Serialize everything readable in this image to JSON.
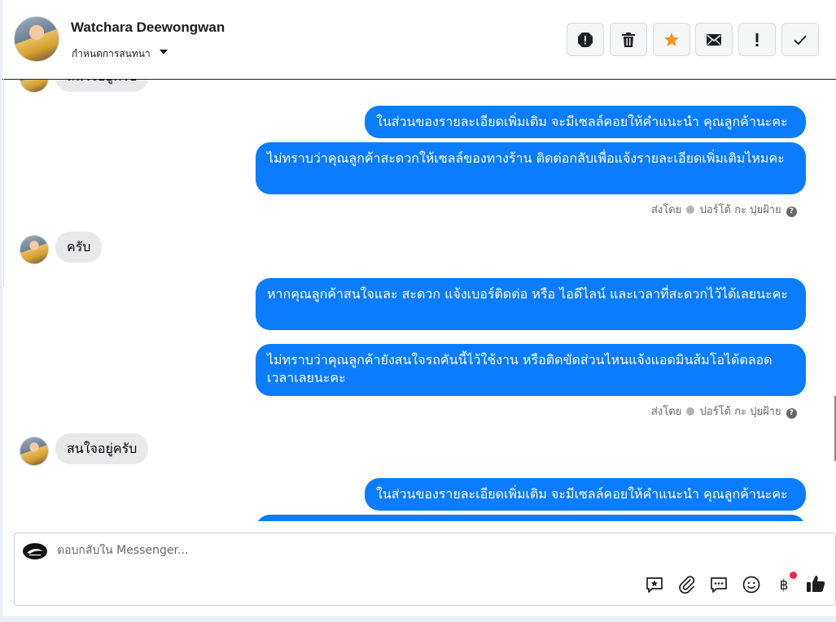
{
  "header": {
    "contact_name": "Watchara Deewongwan",
    "subtitle": "กำหนดการสนทนา",
    "actions": [
      {
        "name": "report-icon"
      },
      {
        "name": "trash-icon"
      },
      {
        "name": "star-icon",
        "color": "#f7931e"
      },
      {
        "name": "mail-icon"
      },
      {
        "name": "exclamation-icon"
      },
      {
        "name": "check-icon"
      }
    ]
  },
  "messages": [
    {
      "from": "customer",
      "text": "สนใจอยู่ครับ"
    },
    {
      "from": "page",
      "text": "ในส่วนของรายละเอียดเพิ่มเติม จะมีเซลล์คอยให้คำแนะนำ คุณลูกค้านะคะ"
    },
    {
      "from": "page",
      "text": "ไม่ทราบว่าคุณลูกค้าสะดวกให้เซลล์ของทางร้าน ติดต่อกลับเพื่อแจ้งรายละเอียดเพิ่มเติมไหมคะ"
    },
    {
      "from": "meta",
      "sent_label": "ส่งโดย",
      "sender": "ปอร์โต้ กะ ปุยฝ้าย"
    },
    {
      "from": "customer",
      "text": "ครับ"
    },
    {
      "from": "page",
      "text": "หากคุณลูกค้าสนใจและ สะดวก แจ้งเบอร์ติดต่อ หรือ ไอดีไลน์ และเวลาที่สะดวกไว้ได้เลยนะคะ"
    },
    {
      "from": "page",
      "text": "ไม่ทราบว่าคุณลูกค้ายังสนใจรถคันนี้ไว้ใช้งาน หรือติดขัดส่วนไหนแจ้งแอดมินส้มโอได้ตลอดเวลาเลยนะคะ"
    },
    {
      "from": "meta",
      "sent_label": "ส่งโดย",
      "sender": "ปอร์โต้ กะ ปุยฝ้าย"
    },
    {
      "from": "customer",
      "text": "สนใจอยู่ครับ"
    },
    {
      "from": "page",
      "text": "ในส่วนของรายละเอียดเพิ่มเติม จะมีเซลล์คอยให้คำแนะนำ คุณลูกค้านะคะ"
    },
    {
      "from": "page",
      "text": ""
    }
  ],
  "composer": {
    "placeholder": "ตอบกลับใน Messenger...",
    "icons": [
      "saved-reply-icon",
      "attachment-icon",
      "chat-bubble-icon",
      "emoji-icon",
      "baht-payment-icon",
      "like-icon"
    ]
  },
  "colors": {
    "outgoing_bubble": "#0a7cff",
    "incoming_bubble": "#e9e9eb",
    "notification_dot": "#f02849"
  }
}
